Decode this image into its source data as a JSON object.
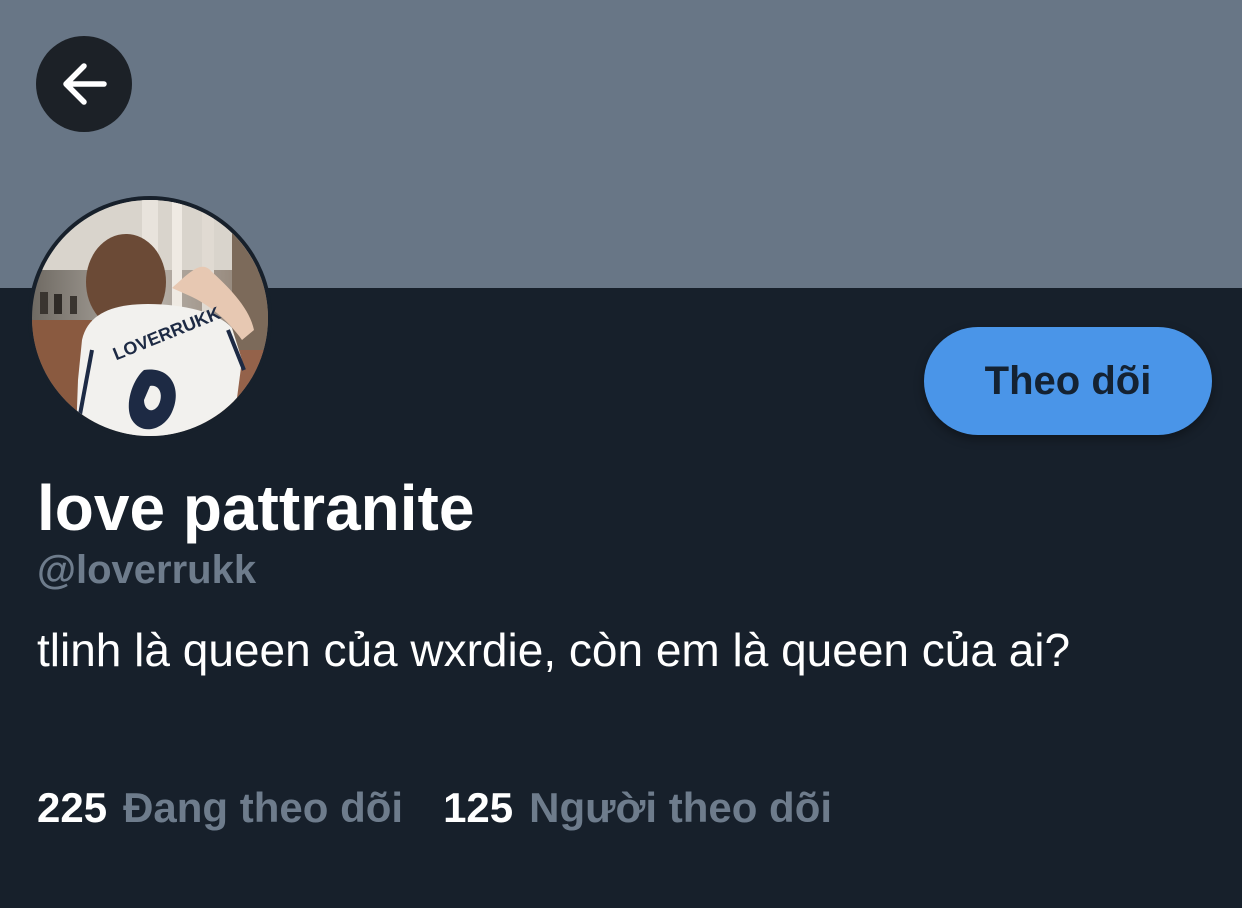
{
  "header": {
    "back_icon": "arrow-left-icon"
  },
  "colors": {
    "banner": "#687686",
    "background": "#17202b",
    "accent": "#4a95e8",
    "muted_text": "#6e7c8c"
  },
  "profile": {
    "display_name": "love pattranite",
    "handle": "@loverrukk",
    "bio": "tlinh là queen của wxrdie, còn em là queen của ai?",
    "follow_label": "Theo dõi",
    "avatar_jersey_text": "LOVERRUKK"
  },
  "stats": {
    "following_count": "225",
    "following_label": "Đang theo dõi",
    "followers_count": "125",
    "followers_label": "Người theo dõi"
  }
}
